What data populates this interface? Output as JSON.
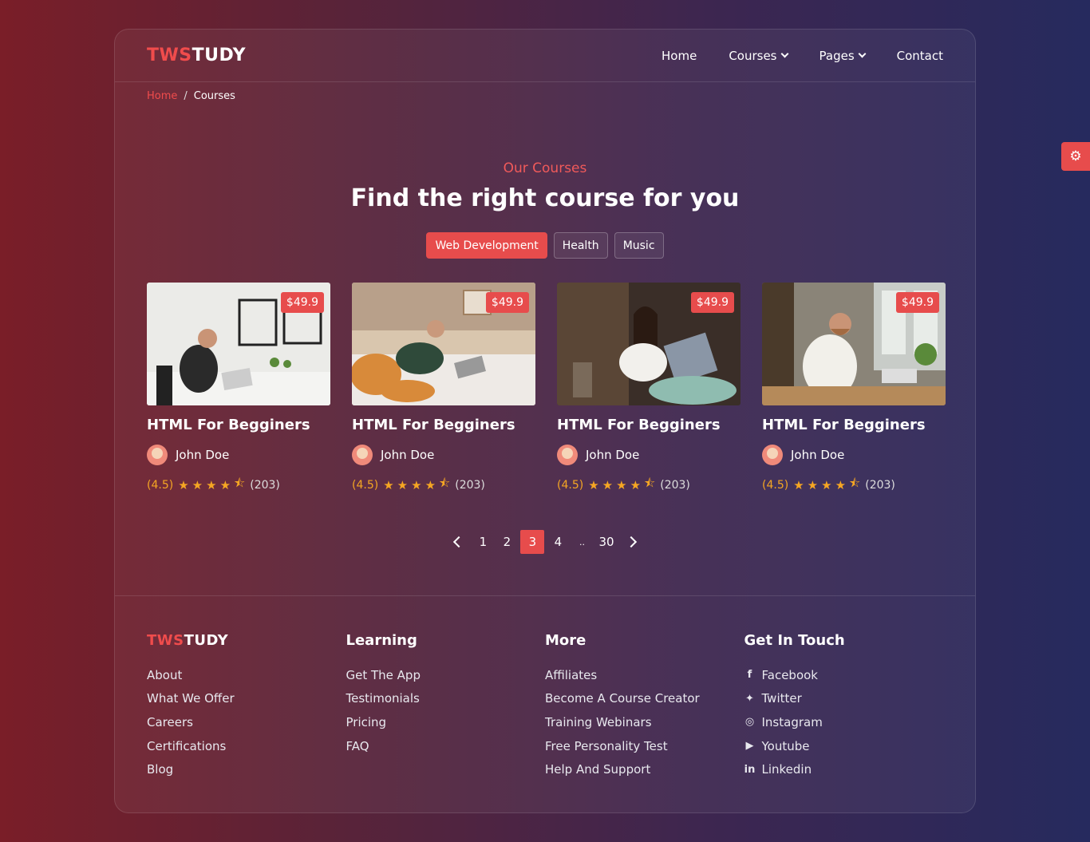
{
  "brand": {
    "part1": "TWS",
    "part2": "TUDY"
  },
  "nav": {
    "home": "Home",
    "courses": "Courses",
    "pages": "Pages",
    "contact": "Contact"
  },
  "breadcrumb": {
    "home": "Home",
    "sep": "/",
    "current": "Courses"
  },
  "section": {
    "kicker": "Our Courses",
    "title": "Find the right course for you"
  },
  "filters": [
    "Web Development",
    "Health",
    "Music"
  ],
  "courses": [
    {
      "price": "$49.9",
      "title": "HTML For Begginers",
      "author": "John Doe",
      "score": "(4.5)",
      "count": "(203)"
    },
    {
      "price": "$49.9",
      "title": "HTML For Begginers",
      "author": "John Doe",
      "score": "(4.5)",
      "count": "(203)"
    },
    {
      "price": "$49.9",
      "title": "HTML For Begginers",
      "author": "John Doe",
      "score": "(4.5)",
      "count": "(203)"
    },
    {
      "price": "$49.9",
      "title": "HTML For Begginers",
      "author": "John Doe",
      "score": "(4.5)",
      "count": "(203)"
    }
  ],
  "rating_value": 4.5,
  "pagination": {
    "pages": [
      "1",
      "2",
      "3",
      "4",
      "..",
      "30"
    ],
    "current": "3"
  },
  "footer": {
    "learning": {
      "title": "Learning",
      "links": [
        "Get The App",
        "Testimonials",
        "Pricing",
        "FAQ"
      ]
    },
    "about": {
      "links": [
        "About",
        "What We Offer",
        "Careers",
        "Certifications",
        "Blog"
      ]
    },
    "more": {
      "title": "More",
      "links": [
        "Affiliates",
        "Become A Course Creator",
        "Training Webinars",
        "Free Personality Test",
        "Help And Support"
      ]
    },
    "contact": {
      "title": "Get In Touch",
      "links": [
        "Facebook",
        "Twitter",
        "Instagram",
        "Youtube",
        "Linkedin"
      ]
    }
  },
  "colors": {
    "accent": "#e74c4c",
    "star": "#f5a623"
  },
  "icons": [
    "chevron-down-icon",
    "star-icon",
    "star-half-icon",
    "chevron-left-icon",
    "chevron-right-icon",
    "facebook-icon",
    "twitter-icon",
    "instagram-icon",
    "youtube-icon",
    "linkedin-icon",
    "gear-icon"
  ]
}
